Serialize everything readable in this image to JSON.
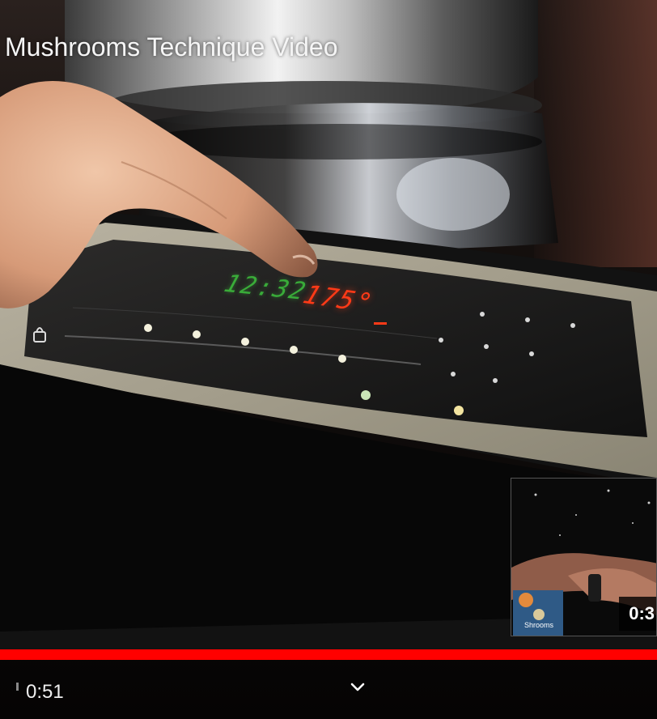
{
  "video": {
    "title": "Mushrooms Technique Video",
    "display_clock": "12:32",
    "display_temp": "175°"
  },
  "preview": {
    "time": "0:3",
    "label": "Shrooms"
  },
  "progress": {
    "played_fraction": 1.0,
    "color": "#ff0000"
  },
  "controls": {
    "current_time": "0:51",
    "chevron_icon": "chevron-down-icon"
  }
}
